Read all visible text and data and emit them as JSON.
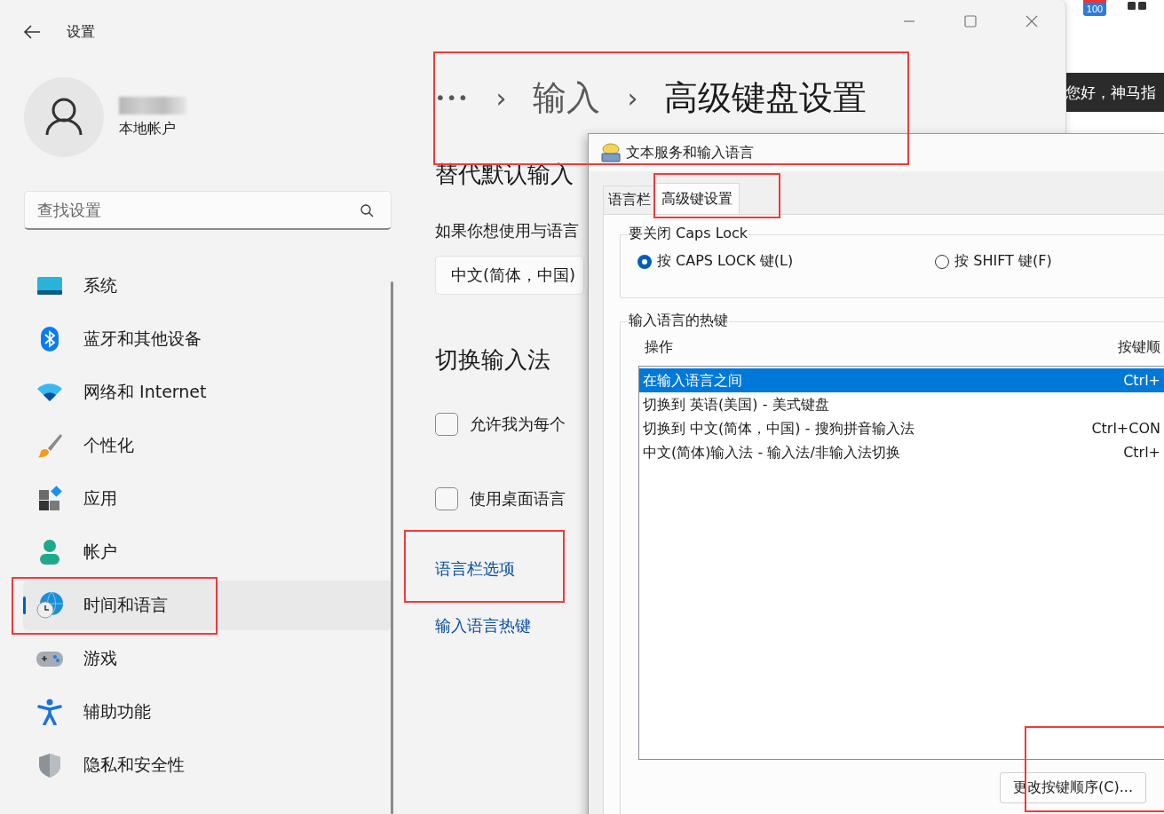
{
  "background": {
    "badge": "100",
    "banner_text": "您好，神马指"
  },
  "settings": {
    "title": "设置",
    "account": {
      "type_label": "本地帐户"
    },
    "search": {
      "placeholder": "查找设置"
    },
    "nav": [
      {
        "label": "系统",
        "selected": false,
        "highlighted": false
      },
      {
        "label": "蓝牙和其他设备",
        "selected": false,
        "highlighted": false
      },
      {
        "label": "网络和 Internet",
        "selected": false,
        "highlighted": false
      },
      {
        "label": "个性化",
        "selected": false,
        "highlighted": false
      },
      {
        "label": "应用",
        "selected": false,
        "highlighted": false
      },
      {
        "label": "帐户",
        "selected": false,
        "highlighted": false
      },
      {
        "label": "时间和语言",
        "selected": true,
        "highlighted": true
      },
      {
        "label": "游戏",
        "selected": false,
        "highlighted": false
      },
      {
        "label": "辅助功能",
        "selected": false,
        "highlighted": false
      },
      {
        "label": "隐私和安全性",
        "selected": false,
        "highlighted": false
      }
    ],
    "breadcrumb": {
      "ellipsis": "•••",
      "separator": "›",
      "parent": "输入",
      "current": "高级键盘设置",
      "highlighted": true
    },
    "section1": {
      "title": "替代默认输入",
      "description": "如果你想使用与语言",
      "dropdown": "中文(简体，中国)"
    },
    "section2": {
      "title": "切换输入法",
      "checkboxes": [
        {
          "label": "允许我为每个",
          "checked": false
        },
        {
          "label": "使用桌面语言",
          "checked": false
        }
      ]
    },
    "links": [
      {
        "label": "语言栏选项",
        "highlighted": true
      },
      {
        "label": "输入语言热键",
        "highlighted": false
      }
    ]
  },
  "dialog": {
    "title": "文本服务和输入语言",
    "tabs": [
      {
        "label": "语言栏",
        "selected": false,
        "highlighted": false
      },
      {
        "label": "高级键设置",
        "selected": true,
        "highlighted": true
      }
    ],
    "caps_group": {
      "title": "要关闭 Caps Lock",
      "options": [
        {
          "label": "按 CAPS LOCK 键(L)",
          "selected": true
        },
        {
          "label": "按 SHIFT 键(F)",
          "selected": false
        }
      ]
    },
    "hotkeys": {
      "title": "输入语言的热键",
      "columns": [
        "操作",
        "按键顺"
      ],
      "rows": [
        {
          "action": "在输入语言之间",
          "keys": "Ctrl+",
          "selected": true
        },
        {
          "action": "切换到 英语(美国) - 美式键盘",
          "selected": false
        },
        {
          "action": "切换到 中文(简体，中国) - 搜狗拼音输入法",
          "keys": "Ctrl+CON",
          "selected": false
        },
        {
          "action": "中文(简体)输入法 - 输入法/非输入法切换",
          "keys": "Ctrl+",
          "selected": false
        }
      ]
    },
    "button": {
      "label": "更改按键顺序(C)...",
      "highlighted": true
    }
  }
}
